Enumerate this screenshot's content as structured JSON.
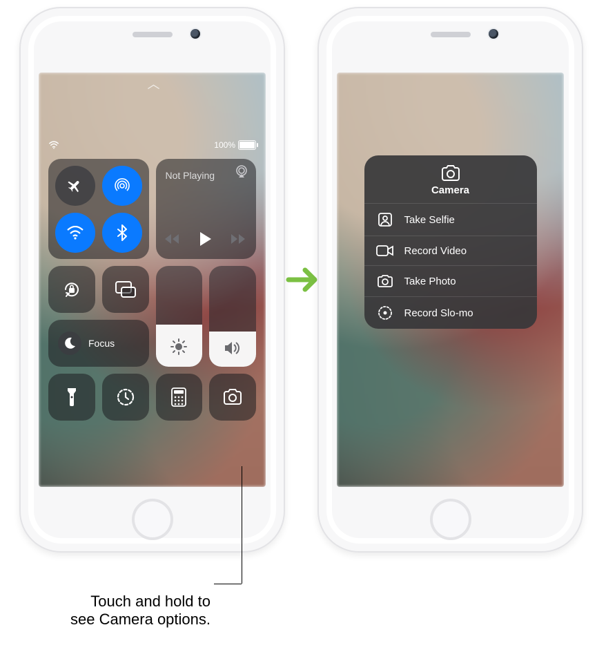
{
  "statusbar": {
    "battery_text": "100%"
  },
  "media": {
    "now_playing": "Not Playing"
  },
  "focus": {
    "label": "Focus"
  },
  "camera_menu": {
    "title": "Camera",
    "items": [
      "Take Selfie",
      "Record Video",
      "Take Photo",
      "Record Slo-mo"
    ]
  },
  "callout": {
    "line1": "Touch and hold to",
    "line2": "see Camera options."
  }
}
